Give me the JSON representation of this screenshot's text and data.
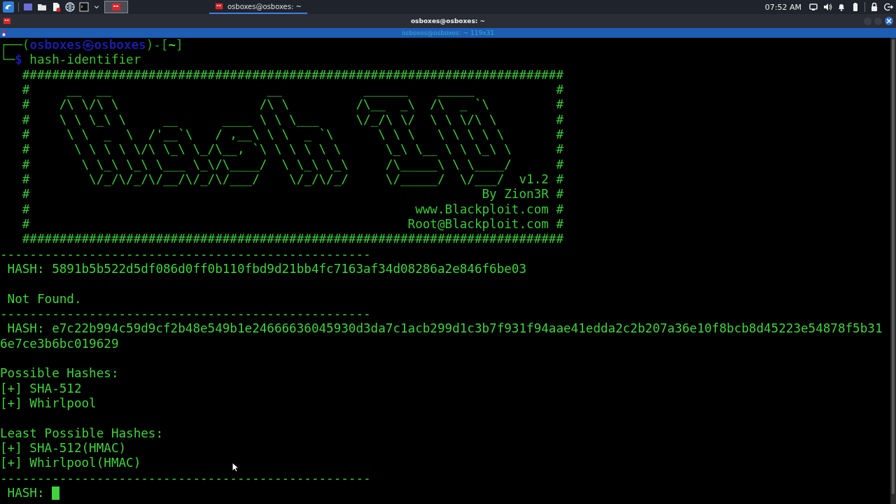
{
  "taskbar": {
    "task": {
      "title": "osboxes@osboxes: ~",
      "selected": true
    },
    "clock": "07:52 AM"
  },
  "window": {
    "title": "osboxes@osboxes: ~",
    "tab_title": "osboxes@osboxes: ~ 119x31"
  },
  "terminal": {
    "prompt": [
      {
        "kind": "frame",
        "text": "┌──("
      },
      {
        "kind": "user",
        "text": "osboxes㉿osboxes"
      },
      {
        "kind": "frame",
        "text": ")-["
      },
      {
        "kind": "dir",
        "text": "~"
      },
      {
        "kind": "frame",
        "text": "]"
      }
    ],
    "command_line": [
      {
        "kind": "frame",
        "text": "└─"
      },
      {
        "kind": "symbol",
        "text": "$"
      },
      {
        "kind": "command",
        "text": " hash-identifier"
      }
    ],
    "lines": [
      {
        "kind": "banner",
        "text": "   #########################################################################"
      },
      {
        "kind": "banner",
        "text": "   #     __  __                     __           ______    _____           #"
      },
      {
        "kind": "banner",
        "text": "   #    /\\ \\/\\ \\                   /\\ \\         /\\__  _\\  /\\  _ `\\         #"
      },
      {
        "kind": "banner",
        "text": "   #    \\ \\ \\_\\ \\     __      ____ \\ \\ \\___     \\/_/\\ \\/  \\ \\ \\/\\ \\        #"
      },
      {
        "kind": "banner",
        "text": "   #     \\ \\  _  \\  /'__`\\   / ,__\\ \\ \\  _ `\\      \\ \\ \\   \\ \\ \\ \\ \\       #"
      },
      {
        "kind": "banner",
        "text": "   #      \\ \\ \\ \\ \\/\\ \\_\\ \\_/\\__, `\\ \\ \\ \\ \\ \\      \\_\\ \\__ \\ \\ \\_\\ \\      #"
      },
      {
        "kind": "banner",
        "text": "   #       \\ \\_\\ \\_\\ \\___ \\_\\/\\____/  \\ \\_\\ \\_\\     /\\_____\\ \\ \\____/      #"
      },
      {
        "kind": "banner",
        "text": "   #        \\/_/\\/_/\\/__/\\/_/\\/___/    \\/_/\\/_/     \\/_____/  \\/___/  v1.2 #"
      },
      {
        "kind": "banner",
        "text": "   #                                                             By Zion3R #"
      },
      {
        "kind": "banner",
        "text": "   #                                                    www.Blackploit.com #"
      },
      {
        "kind": "banner",
        "text": "   #                                                   Root@Blackploit.com #"
      },
      {
        "kind": "banner",
        "text": "   #########################################################################"
      },
      {
        "kind": "rule",
        "text": "--------------------------------------------------"
      },
      {
        "kind": "output",
        "text": " HASH: 5891b5b522d5df086d0ff0b110fbd9d21bb4fc7163af34d08286a2e846f6be03"
      },
      {
        "kind": "blank"
      },
      {
        "kind": "output",
        "text": " Not Found."
      },
      {
        "kind": "rule",
        "text": "--------------------------------------------------"
      },
      {
        "kind": "output",
        "text": " HASH: e7c22b994c59d9cf2b48e549b1e24666636045930d3da7c1acb299d1c3b7f931f94aae41edda2c2b207a36e10f8bcb8d45223e54878f5b31"
      },
      {
        "kind": "output",
        "text": "6e7ce3b6bc019629"
      },
      {
        "kind": "blank"
      },
      {
        "kind": "output",
        "text": "Possible Hashes:"
      },
      {
        "kind": "output",
        "text": "[+] SHA-512"
      },
      {
        "kind": "output",
        "text": "[+] Whirlpool"
      },
      {
        "kind": "blank"
      },
      {
        "kind": "output",
        "text": "Least Possible Hashes:"
      },
      {
        "kind": "output",
        "text": "[+] SHA-512(HMAC)"
      },
      {
        "kind": "output",
        "text": "[+] Whirlpool(HMAC)"
      },
      {
        "kind": "rule",
        "text": "--------------------------------------------------"
      }
    ],
    "input": {
      "prompt": " HASH:",
      "cursor": true
    }
  }
}
